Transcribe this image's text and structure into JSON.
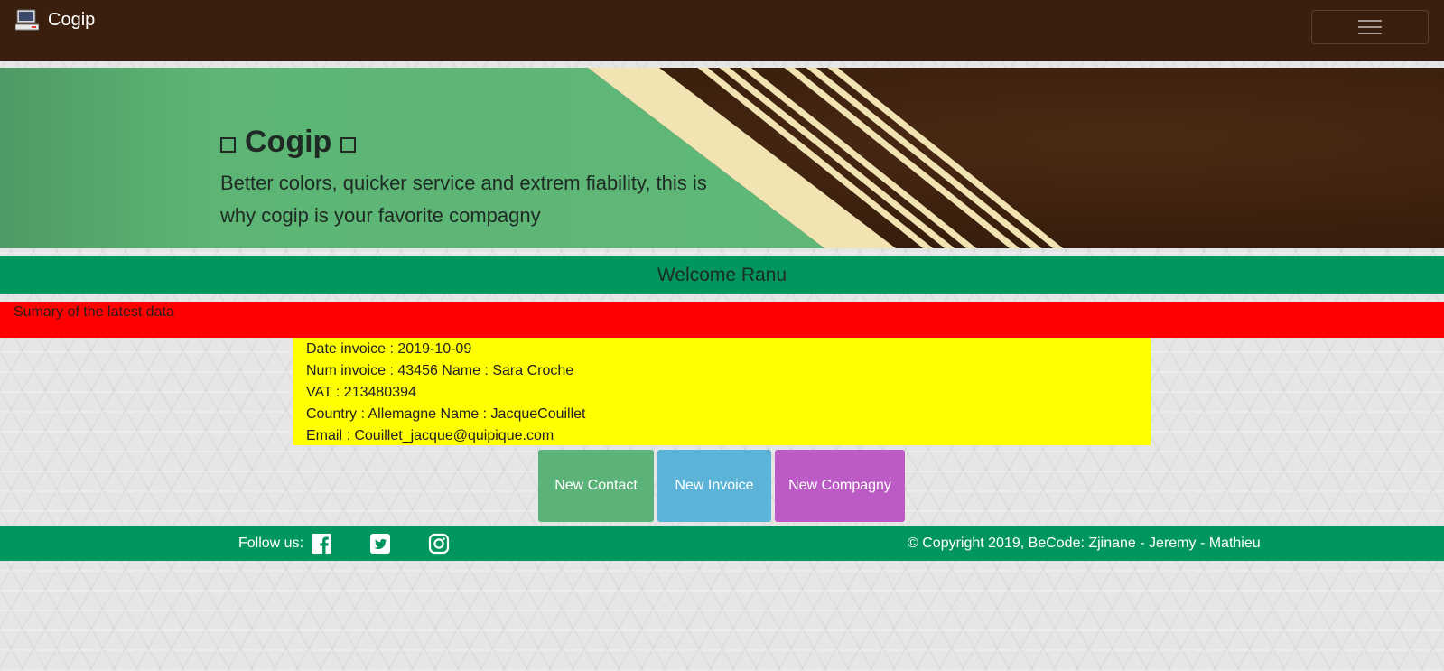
{
  "navbar": {
    "brand": "Cogip",
    "brand_icon": "computer-icon",
    "toggler_icon": "hamburger-menu-icon"
  },
  "hero": {
    "title": "Cogip",
    "title_decoration_icon": "square-outline-icon",
    "subtitle": "Better colors, quicker service and extrem fiability, this is why cogip is your favorite compagny"
  },
  "welcome": "Welcome Ranu",
  "summary_title": "Sumary of the latest data",
  "invoice": {
    "date": "Date invoice : 2019-10-09",
    "num": "Num invoice : 43456 Name : Sara Croche",
    "vat": "VAT : 213480394",
    "country": "Country : Allemagne Name : JacqueCouillet",
    "email": "Email : Couillet_jacque@quipique.com"
  },
  "actions": {
    "new_contact": "New Contact",
    "new_invoice": "New Invoice",
    "new_company": "New Compagny"
  },
  "footer": {
    "follow": "Follow us:",
    "social_icons": [
      "facebook-icon",
      "twitter-icon",
      "instagram-icon"
    ],
    "copyright": "© Copyright 2019, BeCode: Zjinane - Jeremy - Mathieu"
  },
  "colors": {
    "navbar": "#3a1f0e",
    "hero_green": "#5cb574",
    "hero_cream": "#f2e3b3",
    "welcome_bar": "#02965f",
    "summary_bar": "#ff0000",
    "info_card": "#ffff00",
    "btn_contact": "#5bb37a",
    "btn_invoice": "#5cb3d8",
    "btn_company": "#bc5bc5"
  }
}
